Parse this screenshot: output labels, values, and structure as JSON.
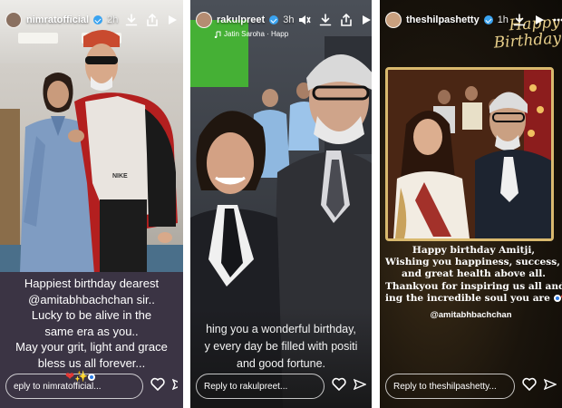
{
  "stories": [
    {
      "username": "nimratofficial",
      "time": "2h",
      "text_lines": [
        "Happiest birthday dearest",
        "@amitabhbachchan sir..",
        "Lucky to be alive in the",
        "same era as you..",
        "May your grit, light and grace",
        "bless us all forever..."
      ],
      "reply_placeholder": "eply to nimratofficial...",
      "shirt_brand": "NIKE"
    },
    {
      "username": "rakulpreet",
      "time": "3h",
      "music_line": "Jatin Saroha · Happ",
      "text_lines": [
        "hing you a wonderful birthday,",
        "y every day be filled with positi",
        "and good fortune."
      ],
      "reply_placeholder": "Reply to rakulpreet..."
    },
    {
      "username": "theshilpashetty",
      "time": "1h",
      "title_line1": "Happy",
      "title_line2": "Birthday",
      "text_lines": [
        "Happy birthday Amitji,",
        "Wishing you happiness, success, peace",
        "and great health above all.",
        "Thankyou for inspiring us all and for",
        "ing the incredible soul you are"
      ],
      "mention": "@amitabhbachchan",
      "reply_placeholder": "Reply to theshilpashetty..."
    }
  ],
  "icons": [
    "download-icon",
    "share-icon",
    "play-icon",
    "mute-icon",
    "more-icon",
    "heart-icon",
    "send-icon",
    "verified-icon"
  ],
  "colors": {
    "verified": "#3aa3f0",
    "heart": "#e53935",
    "gold": "#d9b96e"
  }
}
